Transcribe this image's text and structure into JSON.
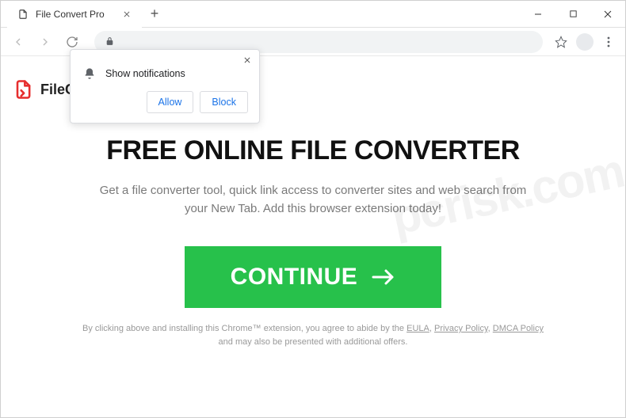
{
  "chrome": {
    "tab_title": "File Convert Pro",
    "newtab": "+",
    "window_controls": {
      "minimize": "−",
      "maximize": "□",
      "close": "×"
    }
  },
  "page": {
    "brand": "FileCo",
    "hero": "FREE ONLINE FILE CONVERTER",
    "subhead": "Get a file converter tool, quick link access to converter sites and web search from your New Tab. Add this browser extension today!",
    "cta_label": "CONTINUE",
    "legal_prefix": "By clicking above and installing this Chrome™ extension, you agree to abide by the ",
    "legal_links": {
      "eula": "EULA",
      "privacy": "Privacy Policy",
      "dmca": "DMCA Policy"
    },
    "legal_mid": " and may also be presented with additional offers."
  },
  "notification": {
    "text": "Show notifications",
    "allow": "Allow",
    "block": "Block"
  },
  "watermark": "pcrisk.com"
}
